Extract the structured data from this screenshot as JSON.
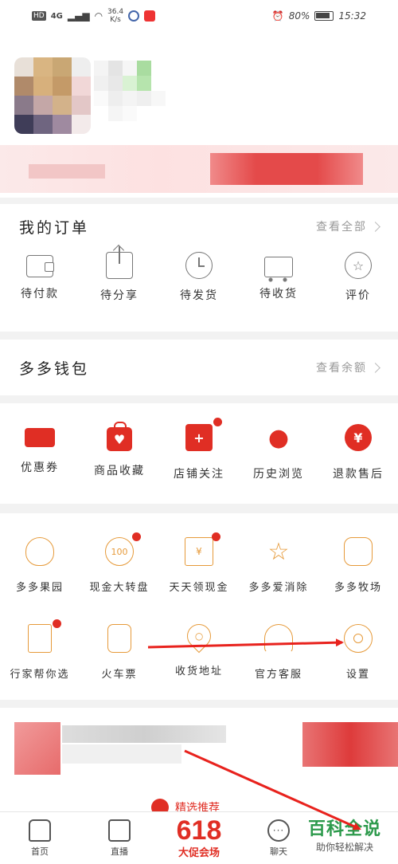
{
  "status_bar": {
    "network_badge": "HD",
    "signal": "4G",
    "speed": "36.4",
    "speed_unit": "K/s",
    "battery": "80%",
    "time": "15:32"
  },
  "orders": {
    "title": "我的订单",
    "view_all": "查看全部",
    "items": [
      {
        "label": "待付款",
        "icon": "wallet-icon"
      },
      {
        "label": "待分享",
        "icon": "share-icon"
      },
      {
        "label": "待发货",
        "icon": "clock-icon"
      },
      {
        "label": "待收货",
        "icon": "truck-icon"
      },
      {
        "label": "评价",
        "icon": "review-icon"
      }
    ]
  },
  "wallet": {
    "title": "多多钱包",
    "view_balance": "查看余额"
  },
  "quick": {
    "items": [
      {
        "label": "优惠券",
        "icon": "coupon-icon"
      },
      {
        "label": "商品收藏",
        "icon": "favorite-bag-icon"
      },
      {
        "label": "店铺关注",
        "icon": "store-follow-icon"
      },
      {
        "label": "历史浏览",
        "icon": "footprint-icon"
      },
      {
        "label": "退款售后",
        "icon": "refund-icon",
        "glyph": "¥"
      }
    ]
  },
  "services": {
    "row1": [
      {
        "label": "多多果园",
        "icon": "tree-icon"
      },
      {
        "label": "现金大转盘",
        "icon": "wheel-icon",
        "glyph": "100"
      },
      {
        "label": "天天领现金",
        "icon": "cash-icon",
        "glyph": "¥"
      },
      {
        "label": "多多爱消除",
        "icon": "star-icon",
        "glyph": "☆"
      },
      {
        "label": "多多牧场",
        "icon": "cow-icon"
      }
    ],
    "row2": [
      {
        "label": "行家帮你选",
        "icon": "expert-doc-icon"
      },
      {
        "label": "火车票",
        "icon": "train-icon"
      },
      {
        "label": "收货地址",
        "icon": "location-pin-icon"
      },
      {
        "label": "官方客服",
        "icon": "headset-icon"
      },
      {
        "label": "设置",
        "icon": "gear-icon"
      }
    ]
  },
  "recommend": {
    "title": "精选推荐"
  },
  "bottom_nav": {
    "home": "首页",
    "live": "直播",
    "promo_number": "618",
    "promo_text": "大促会场",
    "chat": "聊天",
    "chat_glyph": "···"
  },
  "watermark": {
    "main": "百科全说",
    "sub": "助你轻松解决"
  },
  "colors": {
    "accent_red": "#e02e24",
    "service_orange": "#e69a3a",
    "arrow_red": "#e8221d"
  }
}
